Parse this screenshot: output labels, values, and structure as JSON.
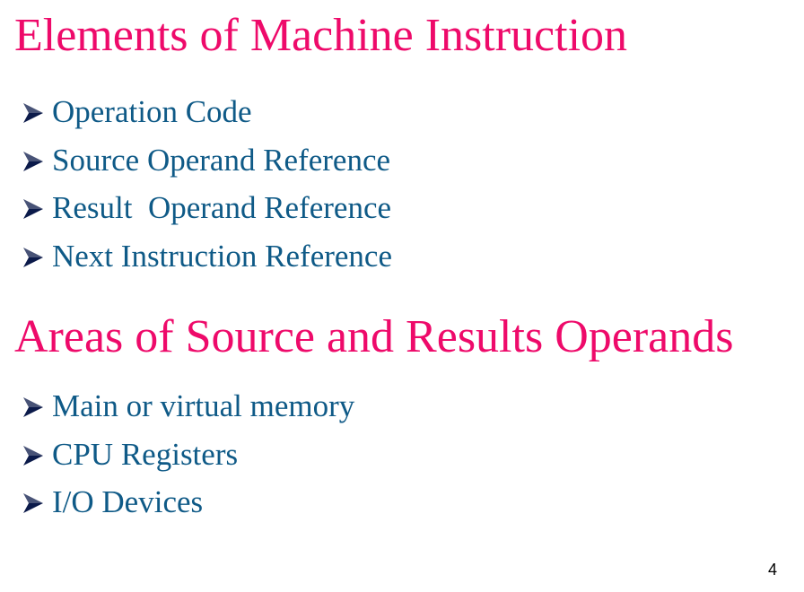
{
  "colors": {
    "heading": "#ee0a6a",
    "bullet_text": "#0f5a87",
    "arrow": "#0b1a4a",
    "page_number": "#000000"
  },
  "icons": {
    "bullet": "arrow-bullet-icon"
  },
  "sections": [
    {
      "heading": "Elements of Machine Instruction",
      "items": [
        "Operation Code",
        "Source Operand Reference",
        "Result  Operand Reference",
        "Next Instruction Reference"
      ]
    },
    {
      "heading": "Areas of Source and Results Operands",
      "items": [
        "Main or virtual memory",
        "CPU Registers",
        "I/O Devices"
      ]
    }
  ],
  "page_number": "4"
}
